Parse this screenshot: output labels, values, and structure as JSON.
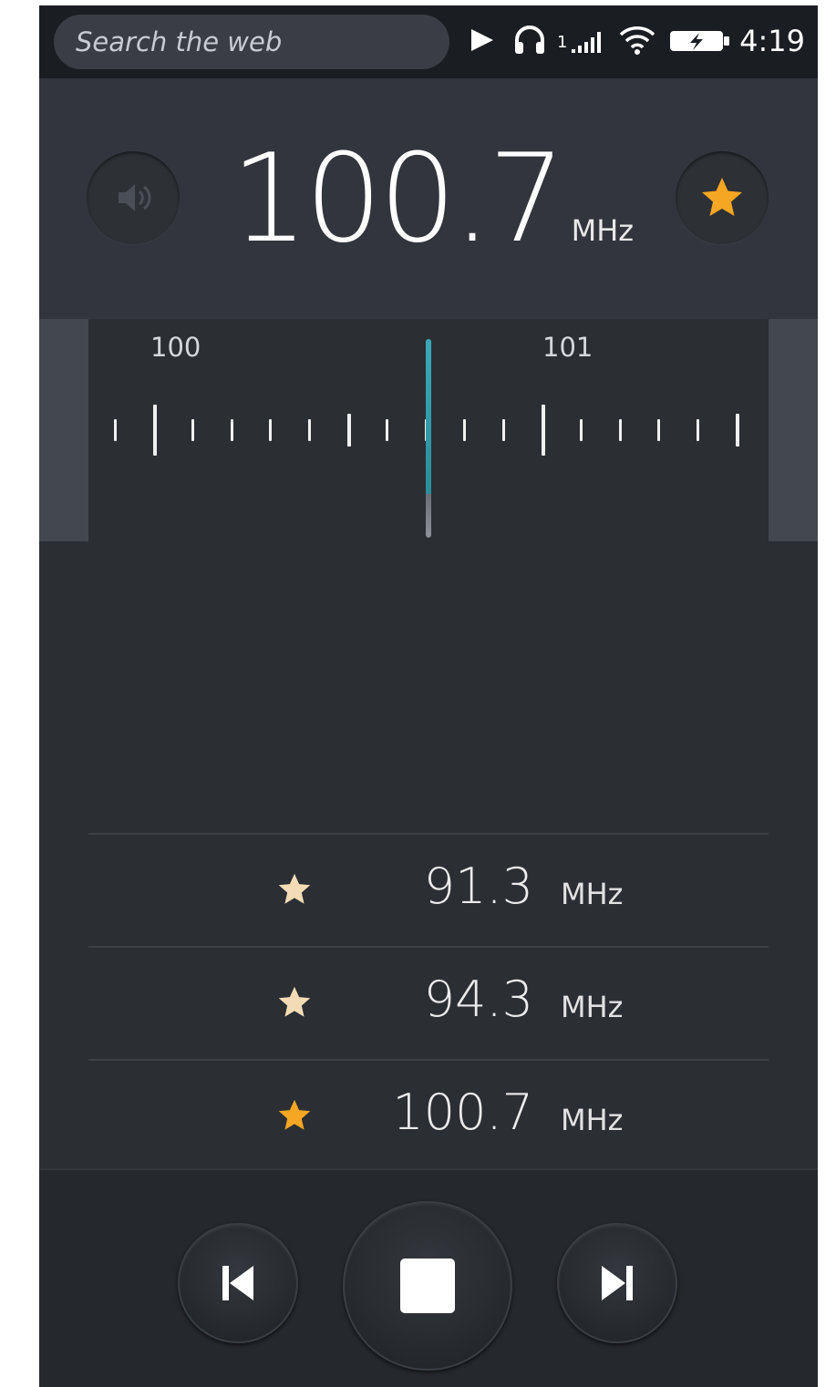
{
  "statusbar": {
    "search_placeholder": "Search the web",
    "signal_sim": "1",
    "time": "4:19",
    "icons": [
      "play-icon",
      "headphones-icon",
      "signal-icon",
      "wifi-icon",
      "battery-charging-icon"
    ]
  },
  "header": {
    "frequency": "100.7",
    "unit": "MHz",
    "speaker_icon": "speaker-icon",
    "favorite_icon": "star-icon",
    "favorite_active": true
  },
  "dial": {
    "labels": [
      "100",
      "101"
    ],
    "tuned_frequency": 100.7
  },
  "presets": [
    {
      "frequency": "91.3",
      "unit": "MHz",
      "active": false
    },
    {
      "frequency": "94.3",
      "unit": "MHz",
      "active": false
    },
    {
      "frequency": "100.7",
      "unit": "MHz",
      "active": true
    }
  ],
  "controls": {
    "previous_icon": "skip-previous-icon",
    "stop_icon": "stop-icon",
    "next_icon": "skip-next-icon"
  },
  "colors": {
    "accent_star": "#f5a623",
    "preset_star": "#f3dcb5",
    "needle": "#3aa9b7",
    "background": "#2b2e33"
  }
}
